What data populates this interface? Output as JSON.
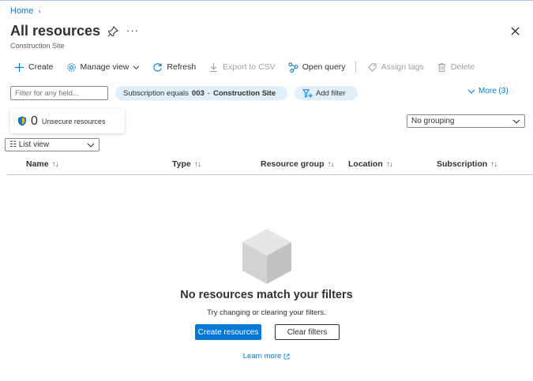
{
  "breadcrumb": {
    "home": "Home",
    "separator": "›"
  },
  "header": {
    "title": "All resources",
    "subtitle": "Construction Site",
    "more": "···"
  },
  "toolbar": {
    "create": "Create",
    "manage_view": "Manage view",
    "refresh": "Refresh",
    "export_csv": "Export to CSV",
    "open_query": "Open query",
    "assign_tags": "Assign tags",
    "delete": "Delete"
  },
  "filters": {
    "placeholder": "Filter for any field...",
    "subscription_prefix": "Subscription equals",
    "subscription_id": "003",
    "subscription_dash": "-",
    "subscription_name": "Construction Site",
    "add_filter": "Add filter",
    "more": "More (3)"
  },
  "security": {
    "count": "0",
    "label": "Unsecure resources"
  },
  "grouping": {
    "selected": "No grouping"
  },
  "view": {
    "selected": "☷ List view"
  },
  "table": {
    "columns": [
      {
        "label": "Name",
        "sort": "↑↓"
      },
      {
        "label": "Type",
        "sort": "↑↓"
      },
      {
        "label": "Resource group",
        "sort": "↑↓"
      },
      {
        "label": "Location",
        "sort": "↑↓"
      },
      {
        "label": "Subscription",
        "sort": "↑↓"
      }
    ]
  },
  "empty": {
    "title": "No resources match your filters",
    "subtitle": "Try changing or clearing your filters.",
    "create_button": "Create resources",
    "clear_button": "Clear filters",
    "learn_more": "Learn more"
  },
  "colors": {
    "accent": "#0078d4",
    "pill": "#e1effa",
    "text": "#323130",
    "disabled": "#a19f9d"
  }
}
